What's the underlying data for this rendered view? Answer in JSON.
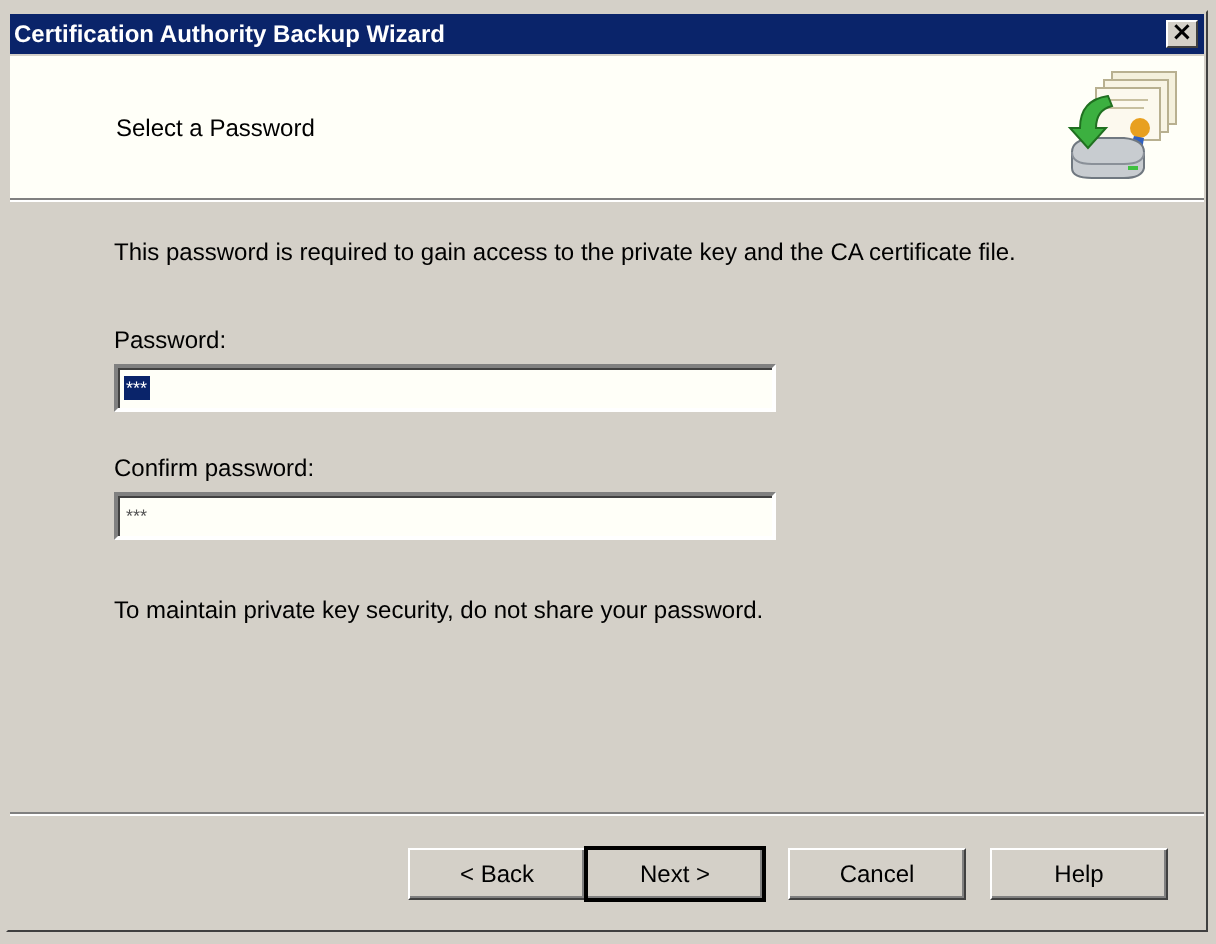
{
  "window": {
    "title": "Certification Authority Backup Wizard",
    "close_label": "×"
  },
  "header": {
    "title": "Select a Password"
  },
  "intro": "This password is required to gain access to the private key and the CA certificate file.",
  "fields": [
    {
      "label": "Password:",
      "value": "***",
      "selected": true
    },
    {
      "label": "Confirm password:",
      "value": "***",
      "selected": false
    }
  ],
  "note": "To maintain private key security, do not share your password.",
  "buttons": [
    {
      "label": "< Back",
      "default": false
    },
    {
      "label": "Next >",
      "default": true
    },
    {
      "label": "Cancel",
      "default": false
    },
    {
      "label": "Help",
      "default": false
    }
  ]
}
